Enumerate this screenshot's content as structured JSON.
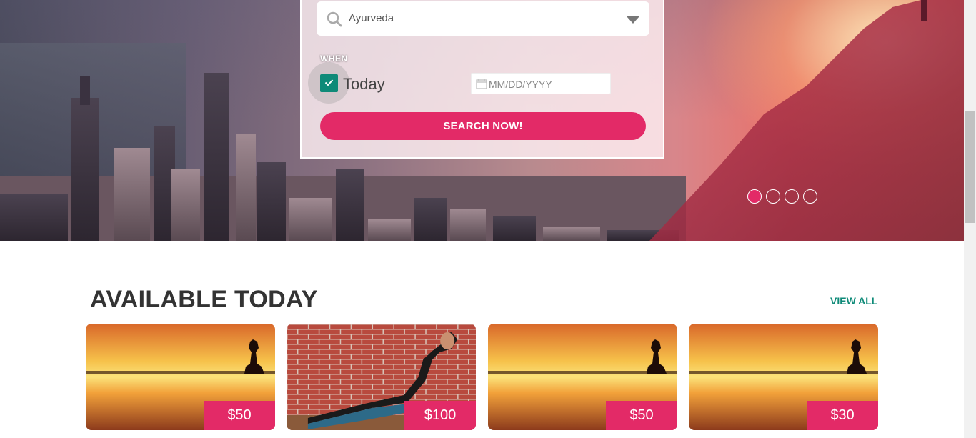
{
  "search": {
    "category_value": "Ayurveda",
    "when_label": "WHEN",
    "today_label": "Today",
    "today_checked": true,
    "date_placeholder": "MM/DD/YYYY",
    "button_label": "SEARCH NOW!"
  },
  "carousel": {
    "slide_count": 4,
    "active_index": 0
  },
  "available_today": {
    "title": "AVAILABLE TODAY",
    "view_all_label": "VIEW ALL",
    "cards": [
      {
        "image": "meditation-sunset",
        "price": "$50"
      },
      {
        "image": "cobra-pose-brick-wall",
        "price": "$100"
      },
      {
        "image": "meditation-sunset",
        "price": "$50"
      },
      {
        "image": "meditation-sunset",
        "price": "$30"
      }
    ]
  },
  "colors": {
    "accent_pink": "#e32a67",
    "accent_teal": "#0e8a78"
  }
}
